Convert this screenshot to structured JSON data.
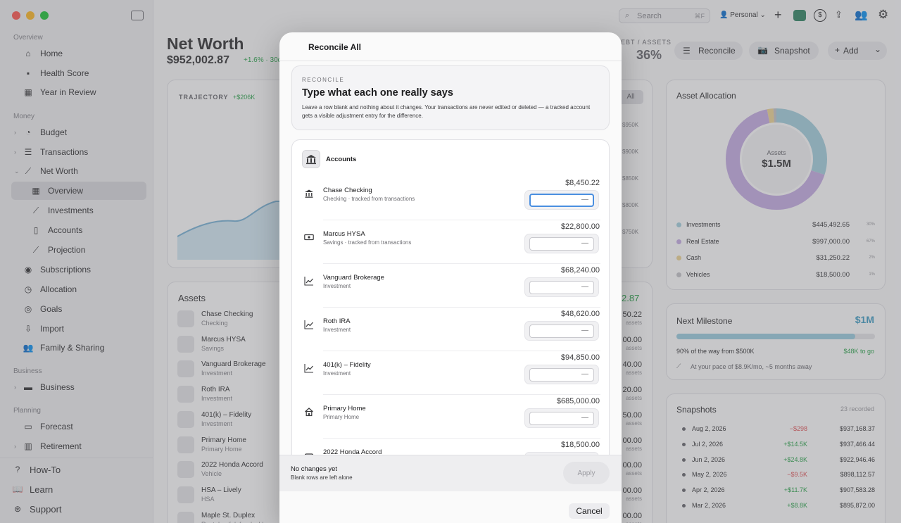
{
  "sidebar": {
    "sections": {
      "overview": "Overview",
      "money": "Money",
      "business": "Business",
      "planning": "Planning"
    },
    "items": {
      "home": "Home",
      "health_score": "Health Score",
      "year_in_review": "Year in Review",
      "budget": "Budget",
      "transactions": "Transactions",
      "net_worth": "Net Worth",
      "nw_overview": "Overview",
      "investments": "Investments",
      "accounts": "Accounts",
      "projection": "Projection",
      "subscriptions": "Subscriptions",
      "allocation": "Allocation",
      "goals": "Goals",
      "import": "Import",
      "family_sharing": "Family & Sharing",
      "business": "Business",
      "forecast": "Forecast",
      "retirement": "Retirement"
    },
    "footer": {
      "howto": "How-To",
      "learn": "Learn",
      "support": "Support"
    }
  },
  "toolbar": {
    "search_placeholder": "Search",
    "search_shortcut": "⌘F",
    "profile": "Personal",
    "reconcile": "Reconcile",
    "snapshot": "Snapshot",
    "add": "Add"
  },
  "header": {
    "title": "Net Worth",
    "amount": "$952,002.87",
    "change": "+1.6% · 30d",
    "debt_assets_label": "EBT / ASSETS",
    "debt_assets_value": "36%"
  },
  "trajectory": {
    "label": "TRAJECTORY",
    "delta": "+$206K",
    "range_all": "All",
    "ticks": [
      "$950K",
      "$900K",
      "$850K",
      "$800K",
      "$750K"
    ]
  },
  "assets_list": {
    "title": "Assets",
    "total_partial": "2.87",
    "items": [
      {
        "name": "Chase Checking",
        "type": "Checking",
        "val": "50.22"
      },
      {
        "name": "Marcus HYSA",
        "type": "Savings",
        "val": "00.00"
      },
      {
        "name": "Vanguard Brokerage",
        "type": "Investment",
        "val": "40.00"
      },
      {
        "name": "Roth IRA",
        "type": "Investment",
        "val": "20.00"
      },
      {
        "name": "401(k) – Fidelity",
        "type": "Investment",
        "val": "50.00"
      },
      {
        "name": "Primary Home",
        "type": "Primary Home",
        "val": "00.00"
      },
      {
        "name": "2022 Honda Accord",
        "type": "Vehicle",
        "val": "00.00"
      },
      {
        "name": "HSA – Lively",
        "type": "HSA",
        "val": "00.00"
      },
      {
        "name": "Maple St. Duplex",
        "type": "Rental · click for dashbo",
        "val": "00.00"
      }
    ],
    "assets_word": "assets"
  },
  "allocation": {
    "title": "Asset Allocation",
    "center_label": "Assets",
    "center_value": "$1.5M",
    "legend": [
      {
        "name": "Investments",
        "value": "$445,492.65",
        "pct": "30%",
        "color": "#a9d3e0"
      },
      {
        "name": "Real Estate",
        "value": "$997,000.00",
        "pct": "67%",
        "color": "#c9b1e6"
      },
      {
        "name": "Cash",
        "value": "$31,250.22",
        "pct": "2%",
        "color": "#efd79a"
      },
      {
        "name": "Vehicles",
        "value": "$18,500.00",
        "pct": "1%",
        "color": "#c7c7cc"
      }
    ]
  },
  "milestone": {
    "title": "Next Milestone",
    "target": "$1M",
    "progress": 0.9,
    "progress_text": "90% of the way from $500K",
    "to_go": "$48K to go",
    "pace": "At your pace of $8.9K/mo, ~5 months away"
  },
  "snapshots": {
    "title": "Snapshots",
    "count": "23 recorded",
    "rows": [
      {
        "date": "Aug 2, 2026",
        "delta": "−$298",
        "value": "$937,168.37",
        "dir": "down"
      },
      {
        "date": "Jul 2, 2026",
        "delta": "+$14.5K",
        "value": "$937,466.44",
        "dir": "up"
      },
      {
        "date": "Jun 2, 2026",
        "delta": "+$24.8K",
        "value": "$922,946.46",
        "dir": "up"
      },
      {
        "date": "May 2, 2026",
        "delta": "−$9.5K",
        "value": "$898,112.57",
        "dir": "down"
      },
      {
        "date": "Apr 2, 2026",
        "delta": "+$11.7K",
        "value": "$907,583.28",
        "dir": "up"
      },
      {
        "date": "Mar 2, 2026",
        "delta": "+$8.8K",
        "value": "$895,872.00",
        "dir": "up"
      }
    ]
  },
  "modal": {
    "title": "Reconcile All",
    "eyebrow": "RECONCILE",
    "heading": "Type what each one really says",
    "description": "Leave a row blank and nothing about it changes. Your transactions are never edited or deleted — a tracked account gets a visible adjustment entry for the difference.",
    "section_title": "Accounts",
    "placeholder": "—",
    "rows": [
      {
        "name": "Chase Checking",
        "sub": "Checking · tracked from transactions",
        "balance": "$8,450.22",
        "icon": "bank"
      },
      {
        "name": "Marcus HYSA",
        "sub": "Savings · tracked from transactions",
        "balance": "$22,800.00",
        "icon": "cash"
      },
      {
        "name": "Vanguard Brokerage",
        "sub": "Investment",
        "balance": "$68,240.00",
        "icon": "chart"
      },
      {
        "name": "Roth IRA",
        "sub": "Investment",
        "balance": "$48,620.00",
        "icon": "chart"
      },
      {
        "name": "401(k) – Fidelity",
        "sub": "Investment",
        "balance": "$94,850.00",
        "icon": "chart"
      },
      {
        "name": "Primary Home",
        "sub": "Primary Home",
        "balance": "$685,000.00",
        "icon": "house"
      },
      {
        "name": "2022 Honda Accord",
        "sub": "",
        "balance": "$18,500.00",
        "icon": "car"
      }
    ],
    "footer_status": "No changes yet",
    "footer_hint": "Blank rows are left alone",
    "apply": "Apply",
    "cancel": "Cancel"
  },
  "colors": {
    "accent_blue": "#4a8fe0",
    "positive": "#34a853",
    "negative": "#e2585b"
  }
}
